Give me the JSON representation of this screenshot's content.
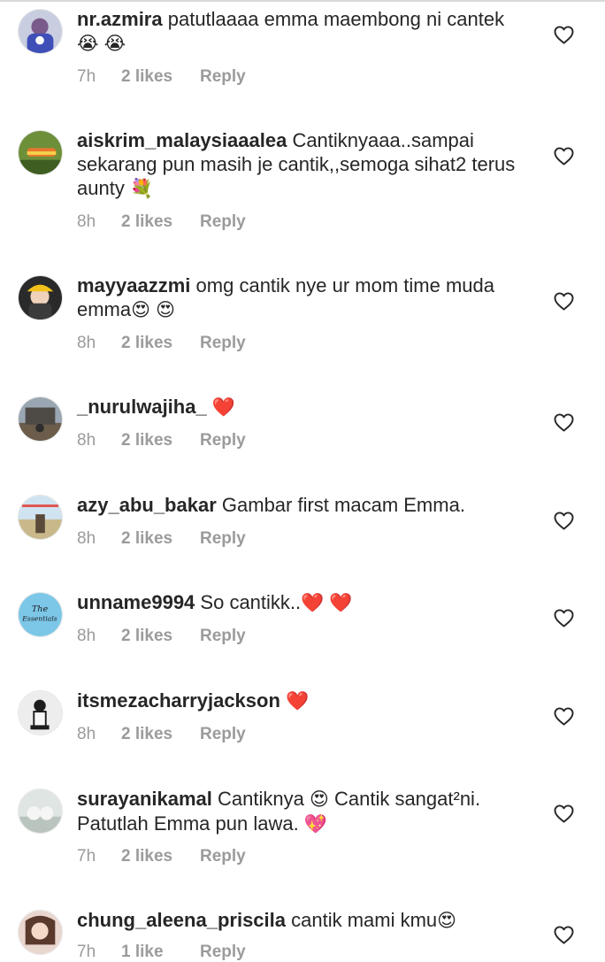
{
  "colors": {
    "text": "#262626",
    "meta": "#9b9b9b",
    "heart_outline": "#262626",
    "red_heart": "#e3242b"
  },
  "comments": [
    {
      "username": "nr.azmira",
      "text": "patutlaaaa emma maembong ni cantek 😭 😭",
      "time": "7h",
      "likes": "2 likes",
      "reply": "Reply"
    },
    {
      "username": "aiskrim_malaysiaaalea",
      "text": "Cantiknyaaa..sampai sekarang pun masih je cantik,,semoga sihat2 terus aunty 💐",
      "time": "8h",
      "likes": "2 likes",
      "reply": "Reply"
    },
    {
      "username": "mayyaazzmi",
      "text": "omg cantik nye ur mom time muda emma😍 😍",
      "time": "8h",
      "likes": "2 likes",
      "reply": "Reply"
    },
    {
      "username": "_nurulwajiha_",
      "text": "❤️",
      "time": "8h",
      "likes": "2 likes",
      "reply": "Reply"
    },
    {
      "username": "azy_abu_bakar",
      "text": "Gambar first macam Emma.",
      "time": "8h",
      "likes": "2 likes",
      "reply": "Reply"
    },
    {
      "username": "unname9994",
      "text": "So cantikk..❤️ ❤️",
      "time": "8h",
      "likes": "2 likes",
      "reply": "Reply"
    },
    {
      "username": "itsmezacharryjackson",
      "text": "❤️",
      "time": "8h",
      "likes": "2 likes",
      "reply": "Reply"
    },
    {
      "username": "surayanikamal",
      "text": "Cantiknya 😍 Cantik sangat²ni. Patutlah Emma pun lawa. 💖",
      "time": "7h",
      "likes": "2 likes",
      "reply": "Reply"
    },
    {
      "username": "chung_aleena_priscila",
      "text": "cantik mami kmu😍",
      "time": "7h",
      "likes": "1 like",
      "reply": "Reply"
    }
  ],
  "avatar_texts": {
    "unname9994": "The Essentials"
  }
}
